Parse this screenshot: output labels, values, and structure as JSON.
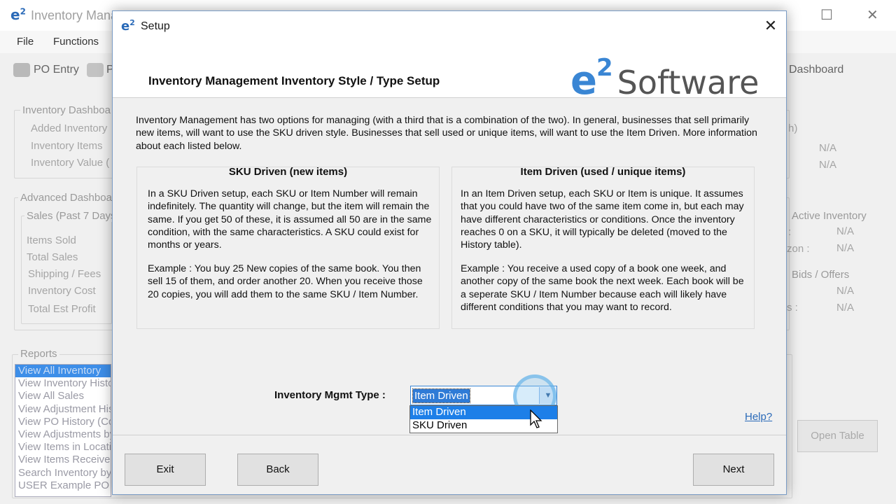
{
  "main_window": {
    "title": "Inventory Mana",
    "menu": [
      "File",
      "Functions"
    ],
    "toolbar": {
      "po_entry": "PO Entry",
      "p_label": "P",
      "dashboard": "Dashboard"
    },
    "inventory_dashboard": {
      "title": "Inventory Dashboa",
      "labels": [
        "Added Inventory",
        "Inventory Items",
        "Inventory Value ("
      ],
      "right_h": "h)",
      "values": [
        "N/A",
        "N/A"
      ]
    },
    "advanced_dashboard": {
      "title": "Advanced Dashboa",
      "sales_title": "Sales (Past 7 Days",
      "labels": [
        "Items Sold",
        "Total Sales",
        "Shipping / Fees",
        "Inventory Cost",
        "Total Est Profit"
      ],
      "active_inventory": "Active Inventory",
      "active_labels": [
        ":",
        "zon :"
      ],
      "active_values": [
        "N/A",
        "N/A"
      ],
      "bids_title": "Bids / Offers",
      "bids_labels": [
        "",
        "s :"
      ],
      "bids_values": [
        "N/A",
        "N/A"
      ]
    },
    "reports": {
      "title": "Reports",
      "items": [
        "View All Inventory",
        "View Inventory Histo",
        "View All Sales",
        "View Adjustment His",
        "View PO History (Co",
        "View Adjustments by",
        "View Items in Locati",
        "View Items Receive",
        "Search Inventory by",
        "USER Example PO"
      ],
      "open_table": "Open Table"
    },
    "window_controls": {
      "maximize": "☐",
      "close": "✕"
    }
  },
  "dialog": {
    "title": "Setup",
    "close_glyph": "✕",
    "header_title": "Inventory Management Inventory Style / Type Setup",
    "brand": {
      "e": "e",
      "sup": "2",
      "software": "Software"
    },
    "intro": "Inventory Management has two options for managing (with a third that is a combination of the two).  In general, businesses that sell primarily new items, will want to use the SKU driven style. Businesses that sell used or unique items, will want to use the Item Driven. More information about each listed below.",
    "sku_panel": {
      "title": "SKU Driven (new items)",
      "p1": "In a SKU Driven setup, each SKU or Item Number will remain indefinitely. The quantity will change, but the item will remain the same. If you get 50 of these, it is assumed all 50 are in the same condition, with the same characteristics.  A SKU could exist for months or years.",
      "p2": "Example : You buy 25 New copies of the same book. You then sell 15 of them, and order another 20. When you receive those 20 copies, you will add them to the same SKU / Item Number."
    },
    "item_panel": {
      "title": "Item Driven (used / unique items)",
      "p1": "In an Item Driven setup, each SKU or Item is unique.  It assumes that you could have two of the same item come in, but each may have different characteristics or conditions. Once the inventory reaches 0 on a SKU, it will typically be deleted (moved to the History table).",
      "p2": "Example : You receive a used copy of a book one week, and another copy of the same book the next week. Each book will be a seperate SKU / Item Number because each will likely have different conditions that you may want to record."
    },
    "type_label": "Inventory Mgmt Type :",
    "combo": {
      "value": "Item Driven",
      "options": [
        "Item Driven",
        "SKU Driven"
      ],
      "highlighted": "Item Driven"
    },
    "help": "Help?",
    "buttons": {
      "exit": "Exit",
      "back": "Back",
      "next": "Next"
    },
    "colors": {
      "accent": "#3a86d4",
      "highlight": "#1d7fe8",
      "link": "#2a6ab8"
    }
  }
}
